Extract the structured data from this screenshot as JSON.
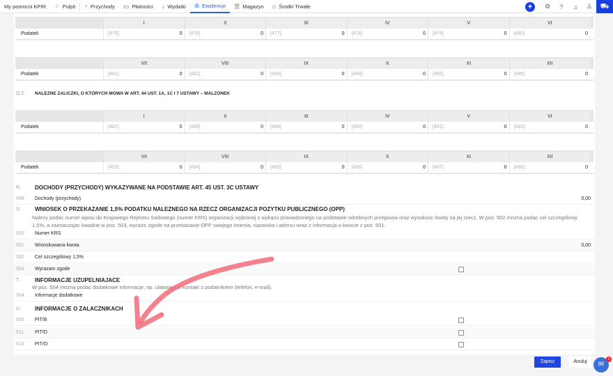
{
  "nav": {
    "items": [
      {
        "label": "My pomocni KPIR",
        "icon": ""
      },
      {
        "label": "Pulpit",
        "icon": "⁘"
      },
      {
        "label": "Przychody",
        "icon": "↑"
      },
      {
        "label": "Płatności",
        "icon": "▭"
      },
      {
        "label": "Wydatki",
        "icon": "↓"
      },
      {
        "label": "Ewidencje",
        "icon": "ılı"
      },
      {
        "label": "Magazyn",
        "icon": "☰"
      },
      {
        "label": "Środki Trwałe",
        "icon": "⌂"
      }
    ],
    "active": "Ewidencje"
  },
  "grid_headers_a": [
    "I",
    "II",
    "III",
    "IV",
    "V",
    "VI"
  ],
  "grid_headers_b": [
    "VII",
    "VIII",
    "IX",
    "X",
    "XI",
    "XII"
  ],
  "row_label": "Podatek",
  "grids": [
    {
      "codes": [
        "[475].",
        "[476].",
        "[477].",
        "[478].",
        "[479].",
        "[480]."
      ],
      "values": [
        "0",
        "0",
        "0",
        "0",
        "0",
        "0"
      ]
    },
    {
      "codes": [
        "[481].",
        "[482].",
        "[483].",
        "[484].",
        "[485].",
        "[486]."
      ],
      "values": [
        "0",
        "0",
        "0",
        "0",
        "0",
        "0"
      ]
    },
    {
      "codes": [
        "[487].",
        "[488].",
        "[489].",
        "[490].",
        "[491].",
        "[492]."
      ],
      "values": [
        "0",
        "0",
        "0",
        "0",
        "0",
        "0"
      ]
    },
    {
      "codes": [
        "[493].",
        "[494].",
        "[495].",
        "[496].",
        "[497].",
        "[498]."
      ],
      "values": [
        "0",
        "0",
        "0",
        "0",
        "0",
        "0"
      ]
    }
  ],
  "sections": {
    "q2": {
      "num": "Q.2.",
      "title": "NALEZNE ZALICZKI, O KTÓRYCH MOWA W ART. 44 UST. 1A, 1C I 7 USTAWY – MALZONEK"
    },
    "r": {
      "num": "R.",
      "title": "DOCHODY (PRZYCHODY) WYKAZYWANE NA PODSTAWIE ART. 45 UST. 3C USTAWY"
    },
    "s": {
      "num": "S.",
      "title": "WNIOSEK O PRZEKAZANIE 1,5% PODATKU NALEZNEGO NA RZECZ ORGANIZACJI POZYTKU PUBLICZNEGO (OPP)",
      "note": "Nalezy podac numer wpisu do Krajowego Rejestru Sadowego (numer KRS) organizacji wybranej z wykazu prowadzonego na podstawie odrebnych przepisów oraz wysokosc kwoty na jej rzecz. W poz. 502 mozna podac cel szczególowy 1,5%, a zaznaczajac kwadrat w poz. 503, wyrazic zgode na przekazanie OPP swojego imienia, nazwiska i adresu wraz z informacja o kwocie z poz. 501."
    },
    "t": {
      "num": "T.",
      "title": "INFORMACJE UZUPELNIAJACE",
      "note": "W poz. 504 mozna podac dodatkowe informacje, np. ulatwiajace kontakt z podatnikiem (telefon, e-mail)."
    },
    "u": {
      "num": "U.",
      "title": "INFORMACJE O ZALACZNIKACH"
    }
  },
  "rows": {
    "r499": {
      "num": "499",
      "label": "Dochody (przychody)",
      "value": "0,00"
    },
    "r500": {
      "num": "500",
      "label": "Numer KRS",
      "value": ""
    },
    "r501": {
      "num": "501",
      "label": "Wnioskowana kwota",
      "value": "0,00"
    },
    "r502": {
      "num": "502",
      "label": "Cel szczególowy 1,5%",
      "value": ""
    },
    "r503": {
      "num": "503",
      "label": "Wyrazam zgode"
    },
    "r504": {
      "num": "504",
      "label": "Informacje dodatkowe"
    },
    "r505": {
      "num": "505",
      "label": "PIT/B"
    },
    "r511": {
      "num": "511",
      "label": "PIT/D"
    },
    "r514": {
      "num": "514",
      "label": "PIT/O"
    }
  },
  "buttons": {
    "save": "Zapisz",
    "cancel": "Anuluj"
  },
  "chat": {
    "badge": "1"
  },
  "colors": {
    "accent": "#2145e0",
    "arrow": "#f26b7a"
  }
}
